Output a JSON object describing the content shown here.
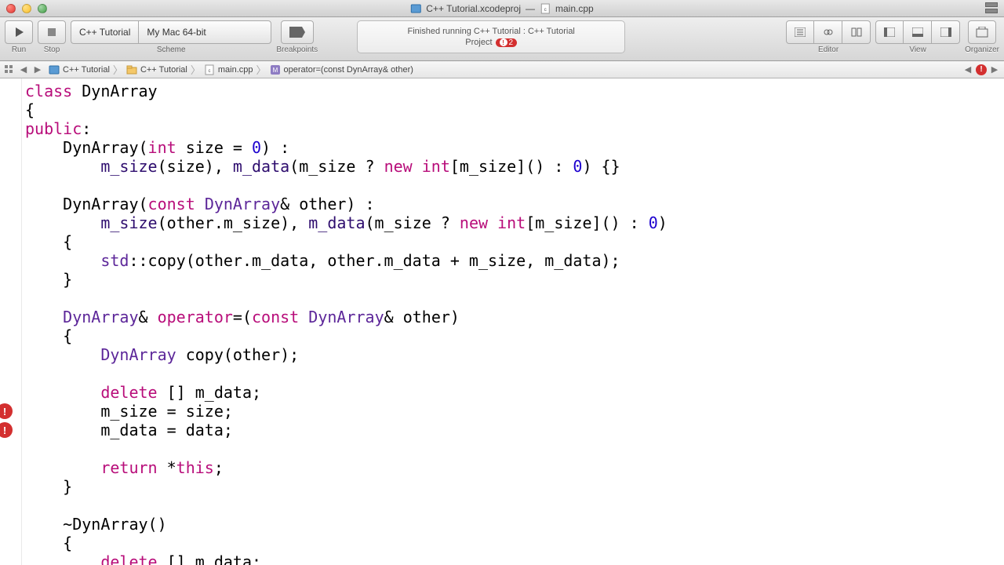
{
  "titlebar": {
    "project_icon": "xcodeproj",
    "project_name": "C++ Tutorial.xcodeproj",
    "separator": "—",
    "file_icon": "cpp",
    "file_name": "main.cpp"
  },
  "toolbar": {
    "run_label": "Run",
    "stop_label": "Stop",
    "scheme_label": "Scheme",
    "scheme_target": "C++ Tutorial",
    "scheme_destination": "My Mac 64-bit",
    "breakpoints_label": "Breakpoints",
    "status_line": "Finished running C++ Tutorial : C++ Tutorial",
    "project_label": "Project",
    "error_count": "2",
    "editor_label": "Editor",
    "view_label": "View",
    "organizer_label": "Organizer"
  },
  "jumpbar": {
    "items": [
      {
        "icon": "xcodeproj",
        "label": "C++ Tutorial"
      },
      {
        "icon": "folder",
        "label": "C++ Tutorial"
      },
      {
        "icon": "cpp",
        "label": "main.cpp"
      },
      {
        "icon": "method",
        "label": "operator=(const DynArray& other)"
      }
    ]
  },
  "editor": {
    "code_tokens": [
      [
        {
          "c": "kw",
          "t": "class"
        },
        {
          "c": "",
          "t": " DynArray"
        }
      ],
      [
        {
          "c": "",
          "t": "{"
        }
      ],
      [
        {
          "c": "kw",
          "t": "public"
        },
        {
          "c": "",
          "t": ":"
        }
      ],
      [
        {
          "c": "",
          "t": "    DynArray("
        },
        {
          "c": "kw",
          "t": "int"
        },
        {
          "c": "",
          "t": " size = "
        },
        {
          "c": "num",
          "t": "0"
        },
        {
          "c": "",
          "t": ") :"
        }
      ],
      [
        {
          "c": "",
          "t": "        "
        },
        {
          "c": "fn",
          "t": "m_size"
        },
        {
          "c": "",
          "t": "(size), "
        },
        {
          "c": "fn",
          "t": "m_data"
        },
        {
          "c": "",
          "t": "(m_size ? "
        },
        {
          "c": "kw",
          "t": "new"
        },
        {
          "c": "",
          "t": " "
        },
        {
          "c": "kw",
          "t": "int"
        },
        {
          "c": "",
          "t": "[m_size]() : "
        },
        {
          "c": "num",
          "t": "0"
        },
        {
          "c": "",
          "t": ") {}"
        }
      ],
      [
        {
          "c": "",
          "t": ""
        }
      ],
      [
        {
          "c": "",
          "t": "    DynArray("
        },
        {
          "c": "kw",
          "t": "const"
        },
        {
          "c": "",
          "t": " "
        },
        {
          "c": "type",
          "t": "DynArray"
        },
        {
          "c": "",
          "t": "& other) :"
        }
      ],
      [
        {
          "c": "",
          "t": "        "
        },
        {
          "c": "fn",
          "t": "m_size"
        },
        {
          "c": "",
          "t": "(other.m_size), "
        },
        {
          "c": "fn",
          "t": "m_data"
        },
        {
          "c": "",
          "t": "(m_size ? "
        },
        {
          "c": "kw",
          "t": "new"
        },
        {
          "c": "",
          "t": " "
        },
        {
          "c": "kw",
          "t": "int"
        },
        {
          "c": "",
          "t": "[m_size]() : "
        },
        {
          "c": "num",
          "t": "0"
        },
        {
          "c": "",
          "t": ")"
        }
      ],
      [
        {
          "c": "",
          "t": "    {"
        }
      ],
      [
        {
          "c": "",
          "t": "        "
        },
        {
          "c": "type",
          "t": "std"
        },
        {
          "c": "",
          "t": "::copy(other.m_data, other.m_data + m_size, m_data);"
        }
      ],
      [
        {
          "c": "",
          "t": "    }"
        }
      ],
      [
        {
          "c": "",
          "t": ""
        }
      ],
      [
        {
          "c": "",
          "t": "    "
        },
        {
          "c": "type",
          "t": "DynArray"
        },
        {
          "c": "",
          "t": "& "
        },
        {
          "c": "kw",
          "t": "operator"
        },
        {
          "c": "",
          "t": "=("
        },
        {
          "c": "kw",
          "t": "const"
        },
        {
          "c": "",
          "t": " "
        },
        {
          "c": "type",
          "t": "DynArray"
        },
        {
          "c": "",
          "t": "& other)"
        }
      ],
      [
        {
          "c": "",
          "t": "    {"
        }
      ],
      [
        {
          "c": "",
          "t": "        "
        },
        {
          "c": "type",
          "t": "DynArray"
        },
        {
          "c": "",
          "t": " copy(other);"
        }
      ],
      [
        {
          "c": "",
          "t": ""
        }
      ],
      [
        {
          "c": "",
          "t": "        "
        },
        {
          "c": "kw",
          "t": "delete"
        },
        {
          "c": "",
          "t": " [] m_data;"
        }
      ],
      [
        {
          "c": "",
          "t": "        m_size = size;"
        }
      ],
      [
        {
          "c": "",
          "t": "        m_data = data;"
        }
      ],
      [
        {
          "c": "",
          "t": ""
        }
      ],
      [
        {
          "c": "",
          "t": "        "
        },
        {
          "c": "kw",
          "t": "return"
        },
        {
          "c": "",
          "t": " *"
        },
        {
          "c": "kw",
          "t": "this"
        },
        {
          "c": "",
          "t": ";"
        }
      ],
      [
        {
          "c": "",
          "t": "    }"
        }
      ],
      [
        {
          "c": "",
          "t": ""
        }
      ],
      [
        {
          "c": "",
          "t": "    ~DynArray()"
        }
      ],
      [
        {
          "c": "",
          "t": "    {"
        }
      ],
      [
        {
          "c": "",
          "t": "        "
        },
        {
          "c": "kw",
          "t": "delete"
        },
        {
          "c": "",
          "t": " [] m_data;"
        }
      ]
    ],
    "error_lines": [
      17,
      18
    ]
  }
}
